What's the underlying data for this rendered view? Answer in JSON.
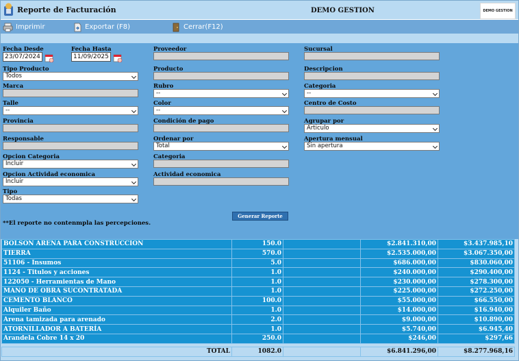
{
  "header": {
    "title": "Reporte de Facturación",
    "company": "DEMO GESTION",
    "logo_text": "DEMO GESTION"
  },
  "toolbar": {
    "print": "Imprimir",
    "export": "Exportar (F8)",
    "close": "Cerrar(F12)"
  },
  "form": {
    "fecha_desde": {
      "label": "Fecha Desde",
      "value": "23/07/2024"
    },
    "fecha_hasta": {
      "label": "Fecha Hasta",
      "value": "11/09/2025"
    },
    "proveedor": {
      "label": "Proveedor"
    },
    "sucursal": {
      "label": "Sucursal"
    },
    "tipo_producto": {
      "label": "Tipo Producto",
      "value": "Todos"
    },
    "producto": {
      "label": "Producto"
    },
    "descripcion": {
      "label": "Descripcion"
    },
    "marca": {
      "label": "Marca"
    },
    "rubro": {
      "label": "Rubro",
      "value": "--"
    },
    "categoria_sel": {
      "label": "Categoria",
      "value": "--"
    },
    "talle": {
      "label": "Talle",
      "value": "--"
    },
    "color": {
      "label": "Color",
      "value": "--"
    },
    "centro_costo": {
      "label": "Centro de Costo"
    },
    "provincia": {
      "label": "Provincia"
    },
    "condicion_pago": {
      "label": "Condición de pago"
    },
    "agrupar_por": {
      "label": "Agrupar por",
      "value": "Articulo"
    },
    "responsable": {
      "label": "Responsable"
    },
    "ordenar_por": {
      "label": "Ordenar por",
      "value": "Total"
    },
    "apertura_mensual": {
      "label": "Apertura mensual",
      "value": "Sin apertura"
    },
    "opcion_categoria": {
      "label": "Opcion Categoria",
      "value": "Incluir"
    },
    "categoria_inp": {
      "label": "Categoria"
    },
    "opcion_actividad": {
      "label": "Opcion Actividad economica",
      "value": "Incluir"
    },
    "actividad_economica": {
      "label": "Actividad economica"
    },
    "tipo": {
      "label": "Tipo",
      "value": "Todas"
    },
    "generate_button": "Generar Reporte",
    "note": "**El reporte no contenmpla las percepciones."
  },
  "report": {
    "rows": [
      {
        "name": "BOLSON ARENA PARA CONSTRUCCION",
        "qty": "150.0",
        "extra": "",
        "neto": "$2.841.310,00",
        "total": "$3.437.985,10"
      },
      {
        "name": "TIERRA",
        "qty": "570.0",
        "extra": "",
        "neto": "$2.535.000,00",
        "total": "$3.067.350,00"
      },
      {
        "name": "51106 - Insumos",
        "qty": "5.0",
        "extra": "",
        "neto": "$686.000,00",
        "total": "$830.060,00"
      },
      {
        "name": "1124 - Titulos y acciones",
        "qty": "1.0",
        "extra": "",
        "neto": "$240.000,00",
        "total": "$290.400,00"
      },
      {
        "name": "122050 - Herramientas de Mano",
        "qty": "1.0",
        "extra": "",
        "neto": "$230.000,00",
        "total": "$278.300,00"
      },
      {
        "name": "MANO DE OBRA SUCONTRATADA",
        "qty": "1.0",
        "extra": "",
        "neto": "$225.000,00",
        "total": "$272.250,00"
      },
      {
        "name": "CEMENTO BLANCO",
        "qty": "100.0",
        "extra": "",
        "neto": "$55.000,00",
        "total": "$66.550,00"
      },
      {
        "name": "Alquiler Baño",
        "qty": "1.0",
        "extra": "",
        "neto": "$14.000,00",
        "total": "$16.940,00"
      },
      {
        "name": "Arena tamizada para arenado",
        "qty": "2.0",
        "extra": "",
        "neto": "$9.000,00",
        "total": "$10.890,00"
      },
      {
        "name": "ATORNILLADOR A BATERÍA",
        "qty": "1.0",
        "extra": "",
        "neto": "$5.740,00",
        "total": "$6.945,40"
      },
      {
        "name": "Arandela Cobre 14 x 20",
        "qty": "250.0",
        "extra": "",
        "neto": "$246,00",
        "total": "$297,66"
      }
    ],
    "total_row": {
      "label": "TOTAL",
      "qty": "1082.0",
      "neto": "$6.841.296,00",
      "total": "$8.277.968,16"
    }
  }
}
